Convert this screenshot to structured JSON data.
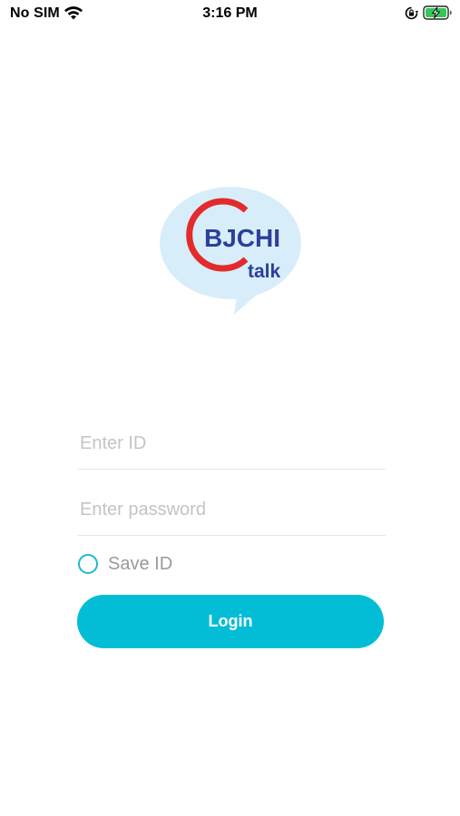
{
  "status_bar": {
    "carrier": "No SIM",
    "time": "3:16 PM",
    "wifi_icon": "wifi-icon",
    "orientation_lock_icon": "orientation-lock-icon",
    "battery_icon": "battery-charging-icon",
    "battery_color": "#34c759"
  },
  "logo": {
    "name": "BJCHI",
    "sub": "talk",
    "bubble_color": "#d7eefa",
    "ring_color": "#e32b2b",
    "text_color": "#2c3f99"
  },
  "form": {
    "id_placeholder": "Enter ID",
    "id_value": "",
    "password_placeholder": "Enter password",
    "password_value": "",
    "save_id_label": "Save ID",
    "save_id_checked": false,
    "accent_color": "#19bcd0"
  },
  "login_button": {
    "label": "Login",
    "color": "#03bdd6"
  }
}
